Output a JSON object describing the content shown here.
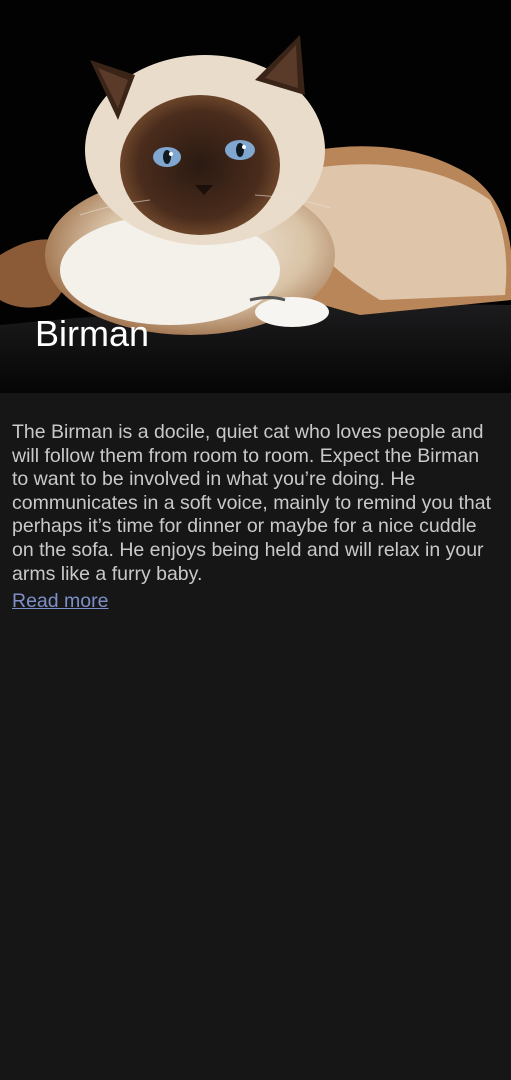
{
  "breed": {
    "name": "Birman",
    "description": "The Birman is a docile, quiet cat who loves people and will follow them from room to room. Expect the Birman to want to be involved in what you’re doing. He communicates in a soft voice, mainly to remind you that perhaps it’s time for dinner or maybe for a nice cuddle on the sofa. He enjoys being held and will relax in your arms like a furry baby.",
    "read_more_label": "Read more"
  },
  "colors": {
    "background": "#161616",
    "link": "#7d90c8",
    "text": "#c9c9c9"
  }
}
